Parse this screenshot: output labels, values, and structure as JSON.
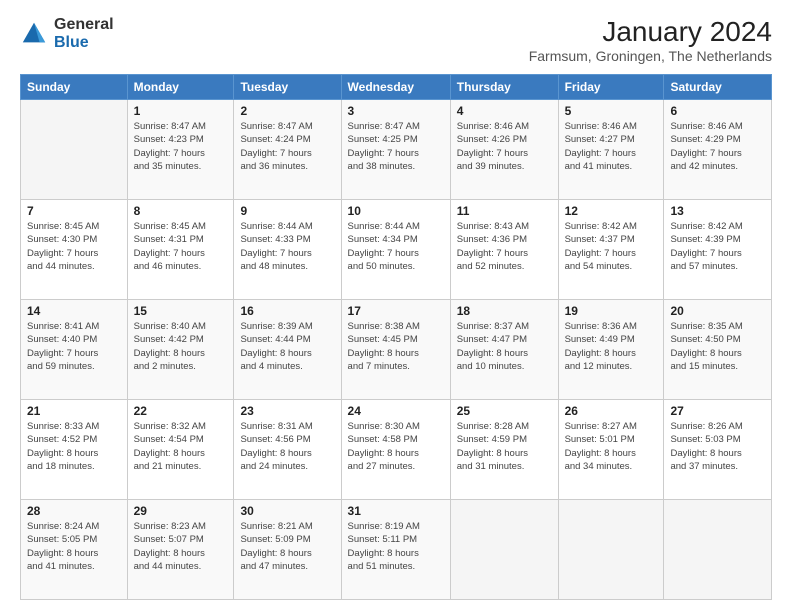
{
  "logo": {
    "general": "General",
    "blue": "Blue"
  },
  "title": "January 2024",
  "location": "Farmsum, Groningen, The Netherlands",
  "days_of_week": [
    "Sunday",
    "Monday",
    "Tuesday",
    "Wednesday",
    "Thursday",
    "Friday",
    "Saturday"
  ],
  "weeks": [
    [
      {
        "date": "",
        "info": ""
      },
      {
        "date": "1",
        "info": "Sunrise: 8:47 AM\nSunset: 4:23 PM\nDaylight: 7 hours\nand 35 minutes."
      },
      {
        "date": "2",
        "info": "Sunrise: 8:47 AM\nSunset: 4:24 PM\nDaylight: 7 hours\nand 36 minutes."
      },
      {
        "date": "3",
        "info": "Sunrise: 8:47 AM\nSunset: 4:25 PM\nDaylight: 7 hours\nand 38 minutes."
      },
      {
        "date": "4",
        "info": "Sunrise: 8:46 AM\nSunset: 4:26 PM\nDaylight: 7 hours\nand 39 minutes."
      },
      {
        "date": "5",
        "info": "Sunrise: 8:46 AM\nSunset: 4:27 PM\nDaylight: 7 hours\nand 41 minutes."
      },
      {
        "date": "6",
        "info": "Sunrise: 8:46 AM\nSunset: 4:29 PM\nDaylight: 7 hours\nand 42 minutes."
      }
    ],
    [
      {
        "date": "7",
        "info": "Sunrise: 8:45 AM\nSunset: 4:30 PM\nDaylight: 7 hours\nand 44 minutes."
      },
      {
        "date": "8",
        "info": "Sunrise: 8:45 AM\nSunset: 4:31 PM\nDaylight: 7 hours\nand 46 minutes."
      },
      {
        "date": "9",
        "info": "Sunrise: 8:44 AM\nSunset: 4:33 PM\nDaylight: 7 hours\nand 48 minutes."
      },
      {
        "date": "10",
        "info": "Sunrise: 8:44 AM\nSunset: 4:34 PM\nDaylight: 7 hours\nand 50 minutes."
      },
      {
        "date": "11",
        "info": "Sunrise: 8:43 AM\nSunset: 4:36 PM\nDaylight: 7 hours\nand 52 minutes."
      },
      {
        "date": "12",
        "info": "Sunrise: 8:42 AM\nSunset: 4:37 PM\nDaylight: 7 hours\nand 54 minutes."
      },
      {
        "date": "13",
        "info": "Sunrise: 8:42 AM\nSunset: 4:39 PM\nDaylight: 7 hours\nand 57 minutes."
      }
    ],
    [
      {
        "date": "14",
        "info": "Sunrise: 8:41 AM\nSunset: 4:40 PM\nDaylight: 7 hours\nand 59 minutes."
      },
      {
        "date": "15",
        "info": "Sunrise: 8:40 AM\nSunset: 4:42 PM\nDaylight: 8 hours\nand 2 minutes."
      },
      {
        "date": "16",
        "info": "Sunrise: 8:39 AM\nSunset: 4:44 PM\nDaylight: 8 hours\nand 4 minutes."
      },
      {
        "date": "17",
        "info": "Sunrise: 8:38 AM\nSunset: 4:45 PM\nDaylight: 8 hours\nand 7 minutes."
      },
      {
        "date": "18",
        "info": "Sunrise: 8:37 AM\nSunset: 4:47 PM\nDaylight: 8 hours\nand 10 minutes."
      },
      {
        "date": "19",
        "info": "Sunrise: 8:36 AM\nSunset: 4:49 PM\nDaylight: 8 hours\nand 12 minutes."
      },
      {
        "date": "20",
        "info": "Sunrise: 8:35 AM\nSunset: 4:50 PM\nDaylight: 8 hours\nand 15 minutes."
      }
    ],
    [
      {
        "date": "21",
        "info": "Sunrise: 8:33 AM\nSunset: 4:52 PM\nDaylight: 8 hours\nand 18 minutes."
      },
      {
        "date": "22",
        "info": "Sunrise: 8:32 AM\nSunset: 4:54 PM\nDaylight: 8 hours\nand 21 minutes."
      },
      {
        "date": "23",
        "info": "Sunrise: 8:31 AM\nSunset: 4:56 PM\nDaylight: 8 hours\nand 24 minutes."
      },
      {
        "date": "24",
        "info": "Sunrise: 8:30 AM\nSunset: 4:58 PM\nDaylight: 8 hours\nand 27 minutes."
      },
      {
        "date": "25",
        "info": "Sunrise: 8:28 AM\nSunset: 4:59 PM\nDaylight: 8 hours\nand 31 minutes."
      },
      {
        "date": "26",
        "info": "Sunrise: 8:27 AM\nSunset: 5:01 PM\nDaylight: 8 hours\nand 34 minutes."
      },
      {
        "date": "27",
        "info": "Sunrise: 8:26 AM\nSunset: 5:03 PM\nDaylight: 8 hours\nand 37 minutes."
      }
    ],
    [
      {
        "date": "28",
        "info": "Sunrise: 8:24 AM\nSunset: 5:05 PM\nDaylight: 8 hours\nand 41 minutes."
      },
      {
        "date": "29",
        "info": "Sunrise: 8:23 AM\nSunset: 5:07 PM\nDaylight: 8 hours\nand 44 minutes."
      },
      {
        "date": "30",
        "info": "Sunrise: 8:21 AM\nSunset: 5:09 PM\nDaylight: 8 hours\nand 47 minutes."
      },
      {
        "date": "31",
        "info": "Sunrise: 8:19 AM\nSunset: 5:11 PM\nDaylight: 8 hours\nand 51 minutes."
      },
      {
        "date": "",
        "info": ""
      },
      {
        "date": "",
        "info": ""
      },
      {
        "date": "",
        "info": ""
      }
    ]
  ]
}
